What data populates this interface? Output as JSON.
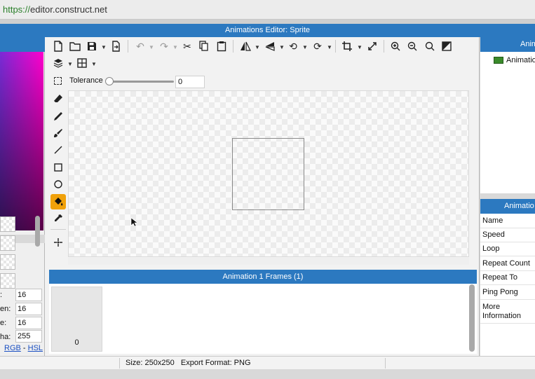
{
  "browser": {
    "url_scheme": "https://",
    "url_rest": "editor.construct.net"
  },
  "window": {
    "title": "Animations Editor: Sprite"
  },
  "options": {
    "tolerance_label": "Tolerance",
    "tolerance_value": "0",
    "tolerance_level": 0
  },
  "color_panel": {
    "components": [
      {
        "label": ":",
        "value": "16"
      },
      {
        "label": "en:",
        "value": "16"
      },
      {
        "label": "e:",
        "value": "16"
      },
      {
        "label": "ha:",
        "value": "255"
      }
    ],
    "mode_rgb": "RGB",
    "mode_sep": " - ",
    "mode_hsl": "HSL"
  },
  "frames": {
    "header": "Animation 1 Frames (1)",
    "items": [
      {
        "index": "0"
      }
    ]
  },
  "animations_panel": {
    "header": "Anim",
    "item": "Animatio"
  },
  "properties_panel": {
    "header": "Animatio",
    "rows": [
      "Name",
      "Speed",
      "Loop",
      "Repeat Count",
      "Repeat To",
      "Ping Pong",
      "More Information"
    ]
  },
  "status": {
    "text": "Size: 250x250   Export Format: PNG"
  },
  "colors": {
    "accent": "#2c79c0",
    "active_tool": "#f0a10a"
  }
}
